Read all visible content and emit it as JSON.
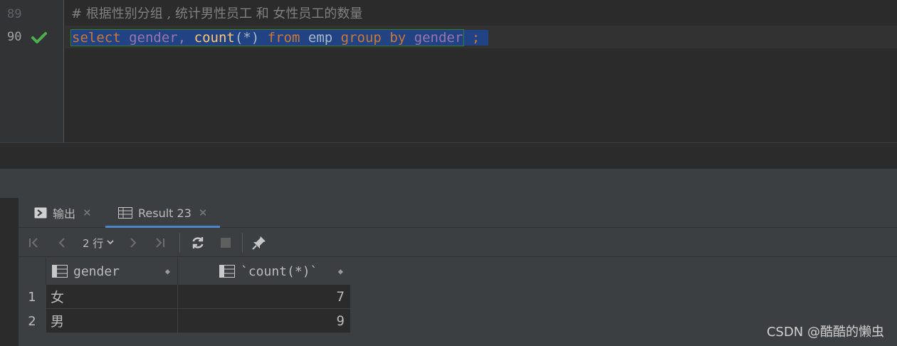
{
  "editor": {
    "lines": [
      {
        "number": "89",
        "text": "# 根据性别分组 , 统计男性员工 和 女性员工的数量"
      },
      {
        "number": "90",
        "tokens": {
          "select": "select",
          "gender": "gender",
          "comma": ",",
          "count": "count",
          "paren_open": "(",
          "star": "*",
          "paren_close": ")",
          "from": "from",
          "emp": "emp",
          "group": "group",
          "by": "by",
          "gender2": "gender",
          "semi": ";"
        }
      }
    ],
    "status_icon": "check-icon",
    "colors": {
      "keyword": "#cc7832",
      "identifier": "#9876aa",
      "function": "#ffc66d",
      "selection": "#214283",
      "check": "#4caf50"
    }
  },
  "panel": {
    "tabs": [
      {
        "label": "输出",
        "icon": "console-icon"
      },
      {
        "label": "Result 23",
        "icon": "table-icon",
        "active": true
      }
    ],
    "toolbar": {
      "rows_label": "2 行",
      "icons": [
        "first-page-icon",
        "prev-page-icon",
        "next-page-icon",
        "last-page-icon",
        "refresh-icon",
        "stop-icon",
        "pin-icon"
      ]
    },
    "grid": {
      "columns": [
        "gender",
        "`count(*)`"
      ],
      "rows": [
        {
          "num": "1",
          "gender": "女",
          "count": "7"
        },
        {
          "num": "2",
          "gender": "男",
          "count": "9"
        }
      ]
    }
  },
  "watermark": "CSDN @酷酷的懒虫"
}
